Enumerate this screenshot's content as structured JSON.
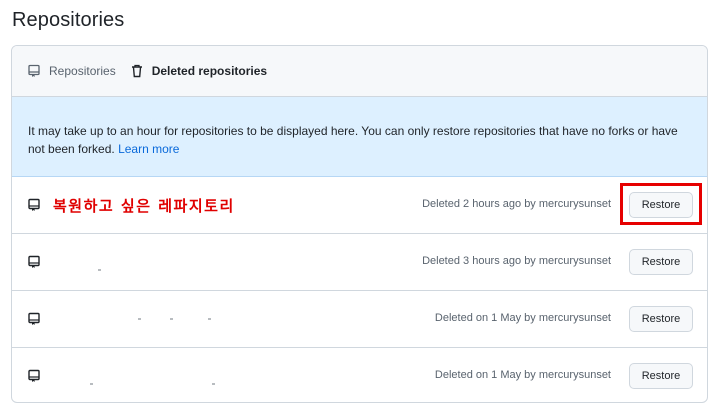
{
  "page": {
    "title": "Repositories"
  },
  "header": {
    "tabs": [
      {
        "label": "Repositories",
        "icon": "repo-icon"
      },
      {
        "label": "Deleted repositories",
        "icon": "trash-icon"
      }
    ]
  },
  "notice": {
    "text": "It may take up to an hour for repositories to be displayed here. You can only restore repositories that have no forks or have not been forked.",
    "link": "Learn more"
  },
  "rows": [
    {
      "name": "복원하고 싶은 레파지토리",
      "deleted": "Deleted 2 hours ago by mercurysunset",
      "button": "Restore"
    },
    {
      "name": "",
      "deleted": "Deleted 3 hours ago by mercurysunset",
      "button": "Restore"
    },
    {
      "name": "",
      "deleted": "Deleted on 1 May by mercurysunset",
      "button": "Restore"
    },
    {
      "name": "",
      "deleted": "Deleted on 1 May by mercurysunset",
      "button": "Restore"
    }
  ],
  "colors": {
    "link": "#0969da",
    "notice_bg": "#ddf0ff",
    "highlight": "#e60000",
    "annotation_text": "#e00000"
  }
}
